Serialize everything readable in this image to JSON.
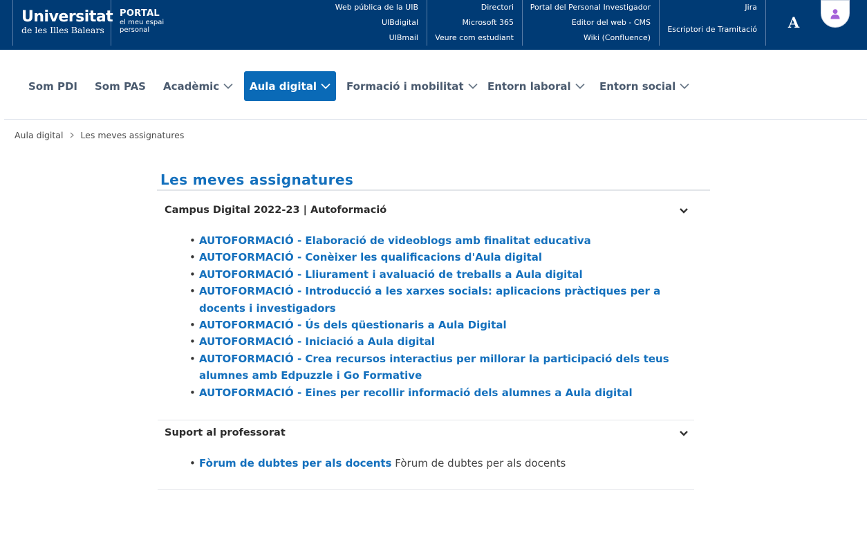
{
  "header": {
    "logo_main": "Universitat",
    "logo_sub": "de les Illes Balears",
    "portal_title": "PORTAL",
    "portal_sub1": "el meu espai",
    "portal_sub2": "personal",
    "links_col1": [
      "Web pública de la UIB",
      "UIBdigital",
      "UIBmail"
    ],
    "links_col2": [
      "Directori",
      "Microsoft 365",
      "Veure com estudiant"
    ],
    "links_col3": [
      "Portal del Personal Investigador",
      "Editor del web - CMS",
      "Wiki (Confluence)"
    ],
    "links_col4": [
      "Jira",
      "Escriptori de Tramitació"
    ],
    "font_size_label": "A",
    "colors": {
      "bar": "#003b75",
      "accent": "#0a6ab7",
      "link": "#1470bd"
    }
  },
  "nav": {
    "items": [
      {
        "label": "Som PDI",
        "has_menu": false
      },
      {
        "label": "Som PAS",
        "has_menu": false
      },
      {
        "label": "Acadèmic",
        "has_menu": true
      },
      {
        "label": "Aula digital",
        "has_menu": true,
        "active": true
      },
      {
        "label": "Formació i mobilitat",
        "has_menu": true
      },
      {
        "label": "Entorn laboral",
        "has_menu": true
      },
      {
        "label": "Entorn social",
        "has_menu": true
      }
    ]
  },
  "breadcrumb": [
    "Aula digital",
    "Les meves assignatures"
  ],
  "main": {
    "title": "Les meves assignatures",
    "sections": [
      {
        "heading": "Campus Digital 2022-23 | Autoformació",
        "items": [
          {
            "link": "AUTOFORMACIÓ - Elaboració de videoblogs amb finalitat educativa"
          },
          {
            "link": "AUTOFORMACIÓ - Conèixer les qualificacions d'Aula digital"
          },
          {
            "link": "AUTOFORMACIÓ - Lliurament i avaluació de treballs a Aula digital"
          },
          {
            "link": "AUTOFORMACIÓ - Introducció a les xarxes socials: aplicacions pràctiques per a docents i investigadors"
          },
          {
            "link": "AUTOFORMACIÓ - Ús dels qüestionaris a Aula Digital"
          },
          {
            "link": "AUTOFORMACIÓ - Iniciació a Aula digital"
          },
          {
            "link": "AUTOFORMACIÓ - Crea recursos interactius per millorar la participació dels teus alumnes amb Edpuzzle i Go Formative"
          },
          {
            "link": "AUTOFORMACIÓ - Eines per recollir informació dels alumnes a Aula digital"
          }
        ]
      },
      {
        "heading": "Suport al professorat",
        "items": [
          {
            "link": "Fòrum de dubtes per als docents",
            "desc": "Fòrum de dubtes per als docents"
          }
        ]
      }
    ]
  },
  "icons": {
    "avatar": "user-icon",
    "nav_chevron": "chevron-down-icon",
    "breadcrumb_sep": "chevron-right-icon",
    "section_toggle": "chevron-down-icon"
  }
}
